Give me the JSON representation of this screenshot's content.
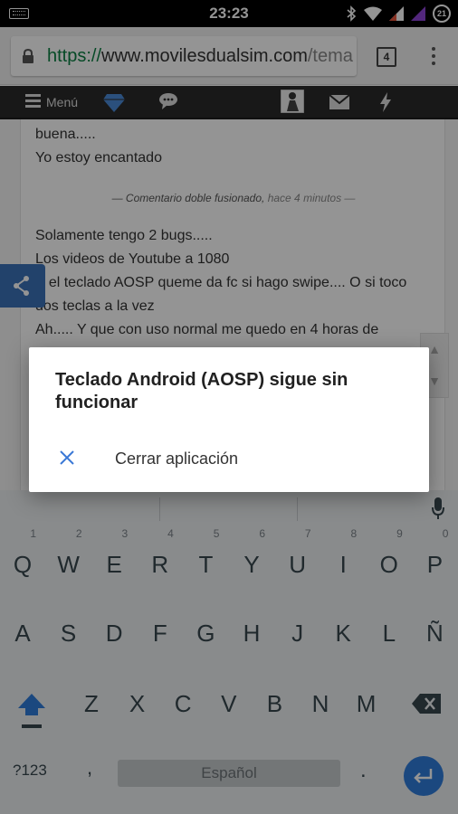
{
  "status_bar": {
    "time": "23:23",
    "battery_level": "21",
    "icons": [
      "keyboard-indicator-icon",
      "bluetooth-icon",
      "wifi-icon",
      "signal-icon",
      "signal-icon-2",
      "battery-icon"
    ]
  },
  "browser": {
    "url_scheme": "https://",
    "url_host": "www.movilesdualsim.com",
    "url_path": "/tema",
    "tab_count": "4"
  },
  "site_nav": {
    "menu_label": "Menú",
    "icons": [
      "hamburger-icon",
      "diamond-icon",
      "chat-icon",
      "avatar",
      "mail-icon",
      "bolt-icon"
    ]
  },
  "content": {
    "line1": "buena.....",
    "line2": "Yo estoy encantado",
    "merge_note_text": "— Comentario doble fusionado,",
    "merge_note_time": "hace 4 minutos —",
    "line3": "Solamente tengo 2 bugs.....",
    "line4": "Los videos de Youtube a 1080",
    "line5": "Y el teclado AOSP queme da fc si hago swipe.... O si toco",
    "line6": "dos teclas a la vez",
    "line7": "Ah..... Y que con uso normal me quedo en 4 horas de"
  },
  "dialog": {
    "title": "Teclado Android (AOSP) sigue sin funcionar",
    "action_label": "Cerrar aplicación",
    "accent": "#3a78d6"
  },
  "keyboard": {
    "row1": [
      {
        "key": "Q",
        "hint": "1"
      },
      {
        "key": "W",
        "hint": "2"
      },
      {
        "key": "E",
        "hint": "3"
      },
      {
        "key": "R",
        "hint": "4"
      },
      {
        "key": "T",
        "hint": "5"
      },
      {
        "key": "Y",
        "hint": "6"
      },
      {
        "key": "U",
        "hint": "7"
      },
      {
        "key": "I",
        "hint": "8"
      },
      {
        "key": "O",
        "hint": "9"
      },
      {
        "key": "P",
        "hint": "0"
      }
    ],
    "row2": [
      "A",
      "S",
      "D",
      "F",
      "G",
      "H",
      "J",
      "K",
      "L",
      "Ñ"
    ],
    "row3": [
      "Z",
      "X",
      "C",
      "V",
      "B",
      "N",
      "M"
    ],
    "symbols_label": "?123",
    "comma": ",",
    "space_label": "Español",
    "period": ".",
    "enter_color": "#2f7ddb"
  }
}
